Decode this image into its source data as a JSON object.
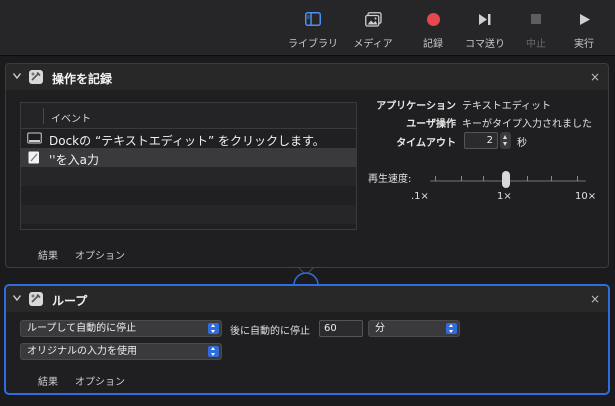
{
  "toolbar": {
    "items": [
      {
        "label": "ライブラリ",
        "icon": "library-sidebar-icon"
      },
      {
        "label": "メディア",
        "icon": "media-photo-icon"
      },
      {
        "label": "記録",
        "icon": "record-icon"
      },
      {
        "label": "コマ送り",
        "icon": "step-icon"
      },
      {
        "label": "中止",
        "icon": "stop-icon"
      },
      {
        "label": "実行",
        "icon": "run-play-icon"
      }
    ]
  },
  "record_panel": {
    "title": "操作を記録",
    "close": "×",
    "table_header": "イベント",
    "events": [
      {
        "text": "Dockの “テキストエディット” をクリックします。",
        "icon": "dock-window-icon"
      },
      {
        "text": "''を入a力",
        "icon": "text-document-icon"
      }
    ],
    "fields": {
      "app_label": "アプリケーション",
      "app_value": "テキストエディット",
      "user_label": "ユーザ操作",
      "user_value": "キーがタイプ入力されました",
      "timeout_label": "タイムアウト",
      "timeout_value": "2",
      "timeout_unit": "秒"
    },
    "speed": {
      "label": "再生速度:",
      "min_label": ".1×",
      "mid_label": "1×",
      "max_label": "10×",
      "value": "1×"
    },
    "tabs": [
      "結果",
      "オプション"
    ]
  },
  "loop_panel": {
    "title": "ループ",
    "close": "×",
    "loop_mode": "ループして自動的に停止",
    "stop_after_label": "後に自動的に停止",
    "stop_after_value": "60",
    "unit": "分",
    "input_mode": "オリジナルの入力を使用",
    "tabs": [
      "結果",
      "オプション"
    ]
  },
  "colors": {
    "accent": "#2f6ce0",
    "record_red": "#e5484d"
  }
}
